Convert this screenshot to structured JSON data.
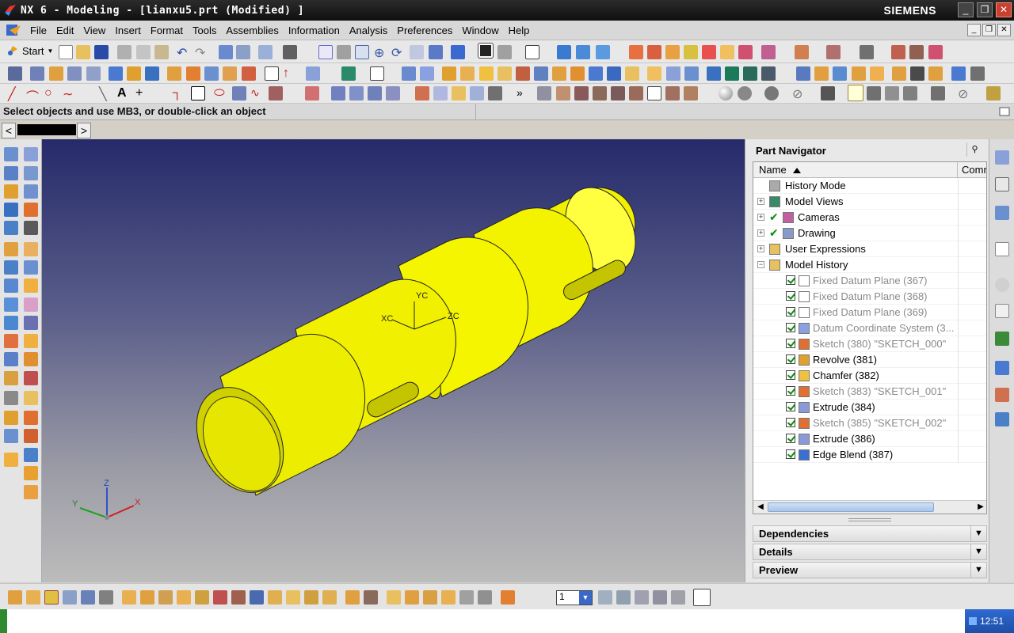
{
  "window": {
    "title": "NX 6 - Modeling - [lianxu5.prt (Modified) ]",
    "brand": "SIEMENS",
    "minimize": "_",
    "restore": "❐",
    "close": "✕"
  },
  "menubar": {
    "items": [
      "File",
      "Edit",
      "View",
      "Insert",
      "Format",
      "Tools",
      "Assemblies",
      "Information",
      "Analysis",
      "Preferences",
      "Window",
      "Help"
    ]
  },
  "toolbar": {
    "start_label": "Start"
  },
  "status": {
    "prompt": "Select objects and use MB3, or double-click an object"
  },
  "viewport": {
    "csys_labels": {
      "xc": "XC",
      "yc": "YC",
      "zc": "ZC"
    },
    "triad_labels": {
      "x": "X",
      "y": "Y",
      "z": "Z"
    },
    "part_color": "#f5f500"
  },
  "part_navigator": {
    "title": "Part Navigator",
    "columns": {
      "name": "Name",
      "comment": "Comm"
    },
    "rows": [
      {
        "label": "History Mode",
        "icon": "clock-icon",
        "expander": ""
      },
      {
        "label": "Model Views",
        "icon": "model-views-icon",
        "expander": "+"
      },
      {
        "label": "Cameras",
        "icon": "camera-icon",
        "expander": "+"
      },
      {
        "label": "Drawing",
        "icon": "drawing-icon",
        "expander": "+"
      },
      {
        "label": "User Expressions",
        "icon": "folder-icon",
        "expander": "+"
      },
      {
        "label": "Model History",
        "icon": "folder-icon",
        "expander": "−"
      },
      {
        "label": "Fixed Datum Plane (367)",
        "icon": "datum-plane-icon",
        "dim": true
      },
      {
        "label": "Fixed Datum Plane (368)",
        "icon": "datum-plane-icon",
        "dim": true
      },
      {
        "label": "Fixed Datum Plane (369)",
        "icon": "datum-plane-icon",
        "dim": true
      },
      {
        "label": "Datum Coordinate System (3...",
        "icon": "datum-csys-icon",
        "dim": true
      },
      {
        "label": "Sketch (380) \"SKETCH_000\"",
        "icon": "sketch-icon",
        "dim": true
      },
      {
        "label": "Revolve (381)",
        "icon": "revolve-icon",
        "dim": false
      },
      {
        "label": "Chamfer (382)",
        "icon": "chamfer-icon",
        "dim": false
      },
      {
        "label": "Sketch (383) \"SKETCH_001\"",
        "icon": "sketch-icon",
        "dim": true
      },
      {
        "label": "Extrude (384)",
        "icon": "extrude-icon",
        "dim": false
      },
      {
        "label": "Sketch (385) \"SKETCH_002\"",
        "icon": "sketch-icon",
        "dim": true
      },
      {
        "label": "Extrude (386)",
        "icon": "extrude-icon",
        "dim": false
      },
      {
        "label": "Edge Blend (387)",
        "icon": "edge-blend-icon",
        "dim": false
      }
    ],
    "panels": [
      "Dependencies",
      "Details",
      "Preview"
    ]
  },
  "bottom": {
    "layer_value": "1"
  },
  "taskbar": {
    "clock": "12:51"
  }
}
